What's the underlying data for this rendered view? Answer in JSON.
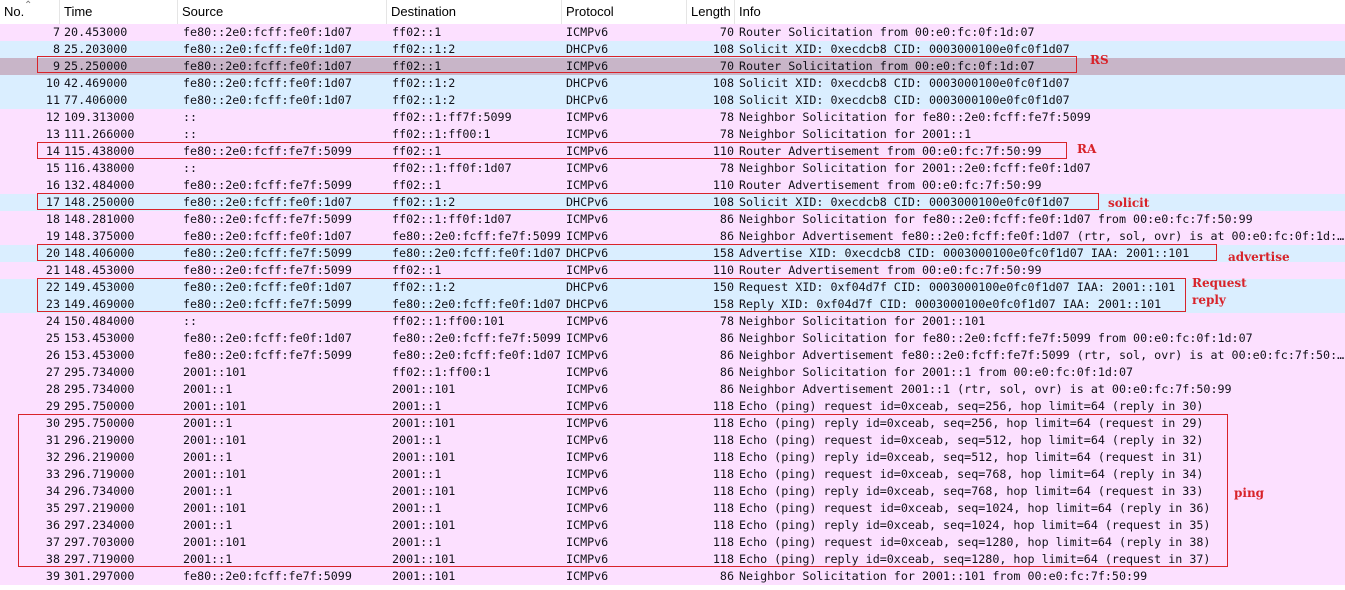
{
  "columns": {
    "no": "No.",
    "time": "Time",
    "source": "Source",
    "destination": "Destination",
    "protocol": "Protocol",
    "length": "Length",
    "info": "Info"
  },
  "sort_icon": "sort-ascending-icon",
  "colors": {
    "icmpv6_row": "#fce0ff",
    "dhcpv6_row": "#daeeff",
    "selected_row": "#c8b5c8",
    "annotation": "#d8232a"
  },
  "packets": [
    {
      "no": "7",
      "time": "20.453000",
      "src": "fe80::2e0:fcff:fe0f:1d07",
      "dst": "ff02::1",
      "proto": "ICMPv6",
      "len": "70",
      "info": "Router Solicitation from 00:e0:fc:0f:1d:07"
    },
    {
      "no": "8",
      "time": "25.203000",
      "src": "fe80::2e0:fcff:fe0f:1d07",
      "dst": "ff02::1:2",
      "proto": "DHCPv6",
      "len": "108",
      "info": "Solicit XID: 0xecdcb8 CID: 0003000100e0fc0f1d07"
    },
    {
      "no": "9",
      "time": "25.250000",
      "src": "fe80::2e0:fcff:fe0f:1d07",
      "dst": "ff02::1",
      "proto": "ICMPv6",
      "len": "70",
      "info": "Router Solicitation from 00:e0:fc:0f:1d:07"
    },
    {
      "no": "10",
      "time": "42.469000",
      "src": "fe80::2e0:fcff:fe0f:1d07",
      "dst": "ff02::1:2",
      "proto": "DHCPv6",
      "len": "108",
      "info": "Solicit XID: 0xecdcb8 CID: 0003000100e0fc0f1d07"
    },
    {
      "no": "11",
      "time": "77.406000",
      "src": "fe80::2e0:fcff:fe0f:1d07",
      "dst": "ff02::1:2",
      "proto": "DHCPv6",
      "len": "108",
      "info": "Solicit XID: 0xecdcb8 CID: 0003000100e0fc0f1d07"
    },
    {
      "no": "12",
      "time": "109.313000",
      "src": "::",
      "dst": "ff02::1:ff7f:5099",
      "proto": "ICMPv6",
      "len": "78",
      "info": "Neighbor Solicitation for fe80::2e0:fcff:fe7f:5099"
    },
    {
      "no": "13",
      "time": "111.266000",
      "src": "::",
      "dst": "ff02::1:ff00:1",
      "proto": "ICMPv6",
      "len": "78",
      "info": "Neighbor Solicitation for 2001::1"
    },
    {
      "no": "14",
      "time": "115.438000",
      "src": "fe80::2e0:fcff:fe7f:5099",
      "dst": "ff02::1",
      "proto": "ICMPv6",
      "len": "110",
      "info": "Router Advertisement from 00:e0:fc:7f:50:99"
    },
    {
      "no": "15",
      "time": "116.438000",
      "src": "::",
      "dst": "ff02::1:ff0f:1d07",
      "proto": "ICMPv6",
      "len": "78",
      "info": "Neighbor Solicitation for 2001::2e0:fcff:fe0f:1d07"
    },
    {
      "no": "16",
      "time": "132.484000",
      "src": "fe80::2e0:fcff:fe7f:5099",
      "dst": "ff02::1",
      "proto": "ICMPv6",
      "len": "110",
      "info": "Router Advertisement from 00:e0:fc:7f:50:99"
    },
    {
      "no": "17",
      "time": "148.250000",
      "src": "fe80::2e0:fcff:fe0f:1d07",
      "dst": "ff02::1:2",
      "proto": "DHCPv6",
      "len": "108",
      "info": "Solicit XID: 0xecdcb8 CID: 0003000100e0fc0f1d07"
    },
    {
      "no": "18",
      "time": "148.281000",
      "src": "fe80::2e0:fcff:fe7f:5099",
      "dst": "ff02::1:ff0f:1d07",
      "proto": "ICMPv6",
      "len": "86",
      "info": "Neighbor Solicitation for fe80::2e0:fcff:fe0f:1d07 from 00:e0:fc:7f:50:99"
    },
    {
      "no": "19",
      "time": "148.375000",
      "src": "fe80::2e0:fcff:fe0f:1d07",
      "dst": "fe80::2e0:fcff:fe7f:5099",
      "proto": "ICMPv6",
      "len": "86",
      "info": "Neighbor Advertisement fe80::2e0:fcff:fe0f:1d07 (rtr, sol, ovr) is at 00:e0:fc:0f:1d:…"
    },
    {
      "no": "20",
      "time": "148.406000",
      "src": "fe80::2e0:fcff:fe7f:5099",
      "dst": "fe80::2e0:fcff:fe0f:1d07",
      "proto": "DHCPv6",
      "len": "158",
      "info": "Advertise XID: 0xecdcb8 CID: 0003000100e0fc0f1d07 IAA: 2001::101"
    },
    {
      "no": "21",
      "time": "148.453000",
      "src": "fe80::2e0:fcff:fe7f:5099",
      "dst": "ff02::1",
      "proto": "ICMPv6",
      "len": "110",
      "info": "Router Advertisement from 00:e0:fc:7f:50:99"
    },
    {
      "no": "22",
      "time": "149.453000",
      "src": "fe80::2e0:fcff:fe0f:1d07",
      "dst": "ff02::1:2",
      "proto": "DHCPv6",
      "len": "150",
      "info": "Request XID: 0xf04d7f CID: 0003000100e0fc0f1d07 IAA: 2001::101"
    },
    {
      "no": "23",
      "time": "149.469000",
      "src": "fe80::2e0:fcff:fe7f:5099",
      "dst": "fe80::2e0:fcff:fe0f:1d07",
      "proto": "DHCPv6",
      "len": "158",
      "info": "Reply XID: 0xf04d7f CID: 0003000100e0fc0f1d07 IAA: 2001::101"
    },
    {
      "no": "24",
      "time": "150.484000",
      "src": "::",
      "dst": "ff02::1:ff00:101",
      "proto": "ICMPv6",
      "len": "78",
      "info": "Neighbor Solicitation for 2001::101"
    },
    {
      "no": "25",
      "time": "153.453000",
      "src": "fe80::2e0:fcff:fe0f:1d07",
      "dst": "fe80::2e0:fcff:fe7f:5099",
      "proto": "ICMPv6",
      "len": "86",
      "info": "Neighbor Solicitation for fe80::2e0:fcff:fe7f:5099 from 00:e0:fc:0f:1d:07"
    },
    {
      "no": "26",
      "time": "153.453000",
      "src": "fe80::2e0:fcff:fe7f:5099",
      "dst": "fe80::2e0:fcff:fe0f:1d07",
      "proto": "ICMPv6",
      "len": "86",
      "info": "Neighbor Advertisement fe80::2e0:fcff:fe7f:5099 (rtr, sol, ovr) is at 00:e0:fc:7f:50:…"
    },
    {
      "no": "27",
      "time": "295.734000",
      "src": "2001::101",
      "dst": "ff02::1:ff00:1",
      "proto": "ICMPv6",
      "len": "86",
      "info": "Neighbor Solicitation for 2001::1 from 00:e0:fc:0f:1d:07"
    },
    {
      "no": "28",
      "time": "295.734000",
      "src": "2001::1",
      "dst": "2001::101",
      "proto": "ICMPv6",
      "len": "86",
      "info": "Neighbor Advertisement 2001::1 (rtr, sol, ovr) is at 00:e0:fc:7f:50:99"
    },
    {
      "no": "29",
      "time": "295.750000",
      "src": "2001::101",
      "dst": "2001::1",
      "proto": "ICMPv6",
      "len": "118",
      "info": "Echo (ping) request id=0xceab, seq=256, hop limit=64 (reply in 30)"
    },
    {
      "no": "30",
      "time": "295.750000",
      "src": "2001::1",
      "dst": "2001::101",
      "proto": "ICMPv6",
      "len": "118",
      "info": "Echo (ping) reply id=0xceab, seq=256, hop limit=64 (request in 29)"
    },
    {
      "no": "31",
      "time": "296.219000",
      "src": "2001::101",
      "dst": "2001::1",
      "proto": "ICMPv6",
      "len": "118",
      "info": "Echo (ping) request id=0xceab, seq=512, hop limit=64 (reply in 32)"
    },
    {
      "no": "32",
      "time": "296.219000",
      "src": "2001::1",
      "dst": "2001::101",
      "proto": "ICMPv6",
      "len": "118",
      "info": "Echo (ping) reply id=0xceab, seq=512, hop limit=64 (request in 31)"
    },
    {
      "no": "33",
      "time": "296.719000",
      "src": "2001::101",
      "dst": "2001::1",
      "proto": "ICMPv6",
      "len": "118",
      "info": "Echo (ping) request id=0xceab, seq=768, hop limit=64 (reply in 34)"
    },
    {
      "no": "34",
      "time": "296.734000",
      "src": "2001::1",
      "dst": "2001::101",
      "proto": "ICMPv6",
      "len": "118",
      "info": "Echo (ping) reply id=0xceab, seq=768, hop limit=64 (request in 33)"
    },
    {
      "no": "35",
      "time": "297.219000",
      "src": "2001::101",
      "dst": "2001::1",
      "proto": "ICMPv6",
      "len": "118",
      "info": "Echo (ping) request id=0xceab, seq=1024, hop limit=64 (reply in 36)"
    },
    {
      "no": "36",
      "time": "297.234000",
      "src": "2001::1",
      "dst": "2001::101",
      "proto": "ICMPv6",
      "len": "118",
      "info": "Echo (ping) reply id=0xceab, seq=1024, hop limit=64 (request in 35)"
    },
    {
      "no": "37",
      "time": "297.703000",
      "src": "2001::101",
      "dst": "2001::1",
      "proto": "ICMPv6",
      "len": "118",
      "info": "Echo (ping) request id=0xceab, seq=1280, hop limit=64 (reply in 38)"
    },
    {
      "no": "38",
      "time": "297.719000",
      "src": "2001::1",
      "dst": "2001::101",
      "proto": "ICMPv6",
      "len": "118",
      "info": "Echo (ping) reply id=0xceab, seq=1280, hop limit=64 (request in 37)"
    },
    {
      "no": "39",
      "time": "301.297000",
      "src": "fe80::2e0:fcff:fe7f:5099",
      "dst": "2001::101",
      "proto": "ICMPv6",
      "len": "86",
      "info": "Neighbor Solicitation for 2001::101 from 00:e0:fc:7f:50:99"
    }
  ],
  "annotations": {
    "rs": "RS",
    "ra": "RA",
    "solicit": "solicit",
    "advertise": "advertise",
    "request": "Request",
    "reply": "reply",
    "ping": "ping"
  }
}
